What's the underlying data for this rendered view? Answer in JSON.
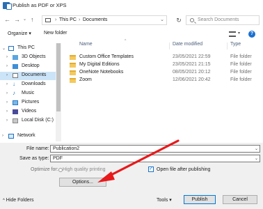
{
  "window": {
    "title": "Publish as PDF or XPS"
  },
  "address": {
    "crumbs": [
      "This PC",
      "Documents"
    ]
  },
  "search": {
    "placeholder": "Search Documents"
  },
  "toolbar": {
    "organize": "Organize",
    "new_folder": "New folder"
  },
  "sidebar": {
    "items": [
      {
        "label": "This PC",
        "icon": "pc-icon"
      },
      {
        "label": "3D Objects",
        "icon": "3d-objects-icon"
      },
      {
        "label": "Desktop",
        "icon": "desktop-icon"
      },
      {
        "label": "Documents",
        "icon": "documents-icon",
        "selected": true
      },
      {
        "label": "Downloads",
        "icon": "downloads-icon"
      },
      {
        "label": "Music",
        "icon": "music-icon"
      },
      {
        "label": "Pictures",
        "icon": "pictures-icon"
      },
      {
        "label": "Videos",
        "icon": "videos-icon"
      },
      {
        "label": "Local Disk (C:)",
        "icon": "disk-icon"
      },
      {
        "label": "Network",
        "icon": "network-icon"
      }
    ]
  },
  "files": {
    "columns": [
      "Name",
      "Date modified",
      "Type"
    ],
    "rows": [
      {
        "name": "Custom Office Templates",
        "date": "23/05/2021 22:59",
        "type": "File folder"
      },
      {
        "name": "My Digital Editions",
        "date": "23/05/2021 21:15",
        "type": "File folder"
      },
      {
        "name": "OneNote Notebooks",
        "date": "08/05/2021 20:12",
        "type": "File folder"
      },
      {
        "name": "Zoom",
        "date": "12/06/2021 20:42",
        "type": "File folder"
      }
    ]
  },
  "form": {
    "file_name_label": "File name:",
    "file_name_value": "Publication2",
    "save_type_label": "Save as type:",
    "save_type_value": "PDF",
    "optimize_label": "Optimize for:",
    "optimize_value": "High quality printing",
    "open_after_label": "Open file after publishing",
    "options_button": "Options..."
  },
  "footer": {
    "hide_folders": "Hide Folders",
    "tools": "Tools",
    "publish": "Publish",
    "cancel": "Cancel"
  },
  "colors": {
    "selection": "#cce4f7",
    "accent": "#0078d7",
    "annotation_arrow": "#e8191b"
  }
}
